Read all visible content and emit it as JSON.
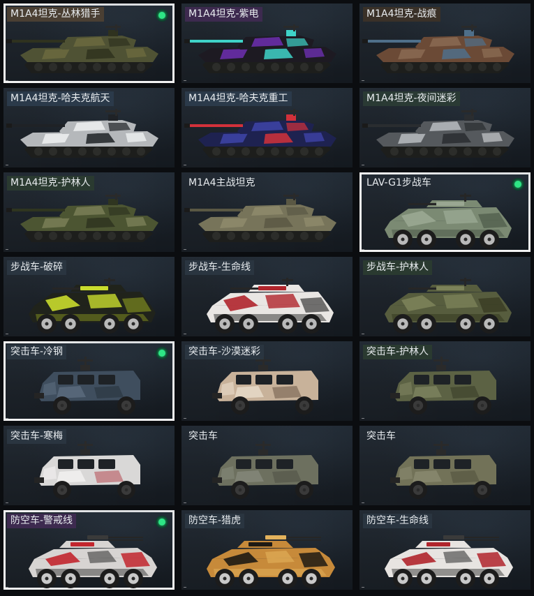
{
  "grid": {
    "cards": [
      {
        "label": "M1A4坦克-丛林猎手",
        "type": "tank",
        "equipped": true,
        "hull_color": "#4f5234",
        "camo_color": "#6b6a3f",
        "accent_color": "#2f321f",
        "label_bg": "#4a3f33"
      },
      {
        "label": "M1A4坦克-紫电",
        "type": "tank",
        "equipped": false,
        "hull_color": "#1d1a22",
        "camo_color": "#6d2fb0",
        "accent_color": "#3fd3c8",
        "label_bg": "#3d2a4f"
      },
      {
        "label": "M1A4坦克-战痕",
        "type": "tank",
        "equipped": false,
        "hull_color": "#6b4a36",
        "camo_color": "#8a6a52",
        "accent_color": "#4f6f8a",
        "label_bg": "#3a3128"
      },
      {
        "label": "M1A4坦克-哈夫克航天",
        "type": "tank",
        "equipped": false,
        "hull_color": "#b5b8bb",
        "camo_color": "#eef0f1",
        "accent_color": "#1f2226",
        "label_bg": "#2b3a4a"
      },
      {
        "label": "M1A4坦克-哈夫克重工",
        "type": "tank",
        "equipped": false,
        "hull_color": "#1e2250",
        "camo_color": "#3e44a8",
        "accent_color": "#d2313a",
        "label_bg": "#2b3a4a"
      },
      {
        "label": "M1A4坦克-夜间迷彩",
        "type": "tank",
        "equipped": false,
        "hull_color": "#55595d",
        "camo_color": "#b9bcbf",
        "accent_color": "#2a2d30",
        "label_bg": "#2a3a34"
      },
      {
        "label": "M1A4坦克-护林人",
        "type": "tank",
        "equipped": false,
        "hull_color": "#4c5532",
        "camo_color": "#7a7f57",
        "accent_color": "#2f3520",
        "label_bg": "#2a3a30"
      },
      {
        "label": "M1A4主战坦克",
        "type": "tank",
        "equipped": false,
        "hull_color": "#77745a",
        "camo_color": "#8e8b6c",
        "accent_color": "#5a5844",
        "label_bg": ""
      },
      {
        "label": "LAV-G1步战车",
        "type": "ifv",
        "equipped": true,
        "hull_color": "#7b8a73",
        "camo_color": "#9aa792",
        "accent_color": "#4d5a48",
        "label_bg": ""
      },
      {
        "label": "步战车-破碎",
        "type": "ifv",
        "equipped": false,
        "hull_color": "#20231b",
        "camo_color": "#c9dc2e",
        "accent_color": "#7d8a1f",
        "label_bg": "#2a3540"
      },
      {
        "label": "步战车-生命线",
        "type": "ifv",
        "equipped": false,
        "hull_color": "#e9e6e3",
        "camo_color": "#b0252c",
        "accent_color": "#3a3a3a",
        "label_bg": "#2a3540"
      },
      {
        "label": "步战车-护林人",
        "type": "ifv",
        "equipped": false,
        "hull_color": "#575d3e",
        "camo_color": "#7c8259",
        "accent_color": "#34381f",
        "label_bg": "#2a3a30"
      },
      {
        "label": "突击车-冷钢",
        "type": "mrap",
        "equipped": true,
        "hull_color": "#3f4e5e",
        "camo_color": "#5c6d7e",
        "accent_color": "#27313b",
        "label_bg": "#2a3540"
      },
      {
        "label": "突击车-沙漠迷彩",
        "type": "mrap",
        "equipped": false,
        "hull_color": "#c8b29a",
        "camo_color": "#e9dccb",
        "accent_color": "#6b5747",
        "label_bg": "#2a3540"
      },
      {
        "label": "突击车-护林人",
        "type": "mrap",
        "equipped": false,
        "hull_color": "#5c6244",
        "camo_color": "#7e8460",
        "accent_color": "#363b27",
        "label_bg": "#2a3a30"
      },
      {
        "label": "突击车-寒梅",
        "type": "mrap",
        "equipped": false,
        "hull_color": "#d9d8d7",
        "camo_color": "#f3f2f1",
        "accent_color": "#b54a52",
        "label_bg": "#2a3540"
      },
      {
        "label": "突击车",
        "type": "mrap",
        "equipped": false,
        "hull_color": "#6d705f",
        "camo_color": "#85887a",
        "accent_color": "#4e5044",
        "label_bg": ""
      },
      {
        "label": "突击车",
        "type": "mrap",
        "equipped": false,
        "hull_color": "#727258",
        "camo_color": "#8a8a70",
        "accent_color": "#50503d",
        "label_bg": ""
      },
      {
        "label": "防空车-警戒线",
        "type": "aa",
        "equipped": true,
        "hull_color": "#d7d4d2",
        "camo_color": "#c2262e",
        "accent_color": "#3a3a3a",
        "label_bg": "#3d2a4f"
      },
      {
        "label": "防空车-猎虎",
        "type": "aa",
        "equipped": false,
        "hull_color": "#c78a3a",
        "camo_color": "#1e1a14",
        "accent_color": "#e3b25c",
        "label_bg": "#2a3540"
      },
      {
        "label": "防空车-生命线",
        "type": "aa",
        "equipped": false,
        "hull_color": "#e7e4e1",
        "camo_color": "#b0252c",
        "accent_color": "#3a3a3a",
        "label_bg": "#2a3540"
      }
    ]
  }
}
